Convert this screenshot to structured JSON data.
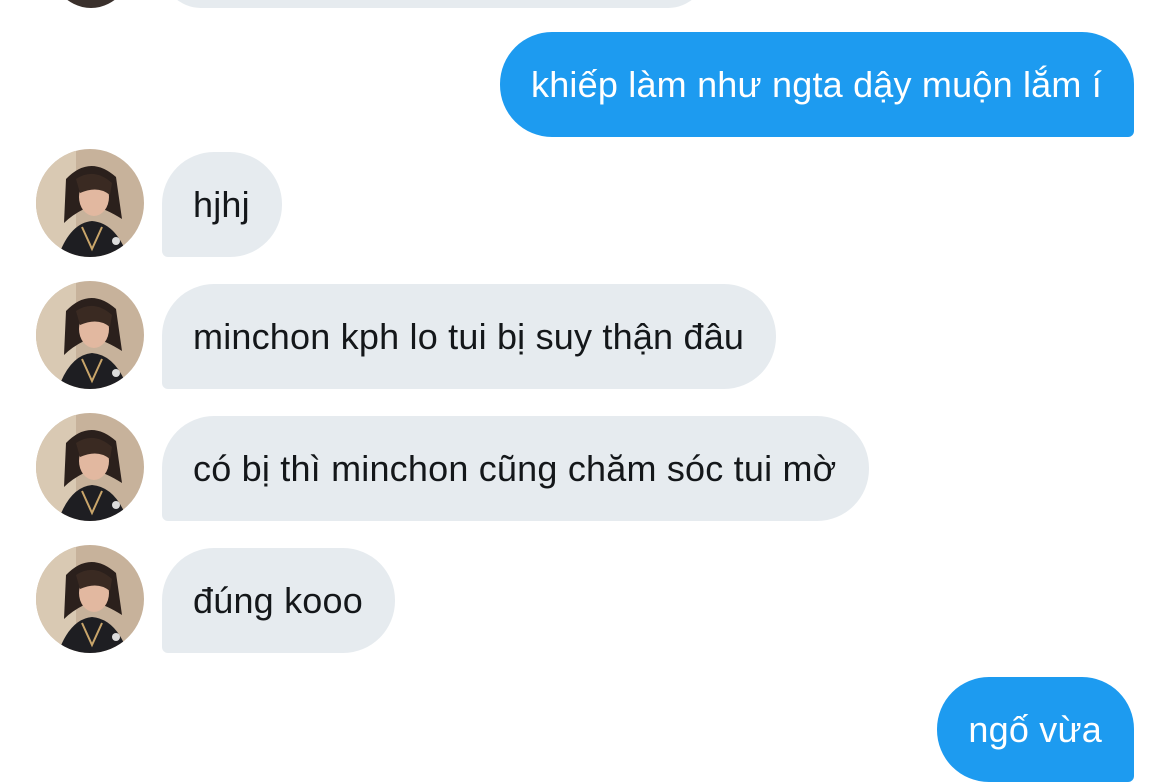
{
  "conversation": {
    "messages": [
      {
        "from": "me",
        "text": "khiếp làm như ngta dậy muộn lắm í"
      },
      {
        "from": "them",
        "text": "hjhj"
      },
      {
        "from": "them",
        "text": "minchon kph lo tui bị suy thận đâu"
      },
      {
        "from": "them",
        "text": "có bị thì minchon cũng chăm sóc tui mờ"
      },
      {
        "from": "them",
        "text": "đúng kooo"
      },
      {
        "from": "me",
        "text": "ngố vừa"
      }
    ]
  },
  "colors": {
    "sent_bubble": "#1d9bf0",
    "received_bubble": "#e6ebef",
    "sent_text": "#ffffff",
    "received_text": "#14171a"
  }
}
